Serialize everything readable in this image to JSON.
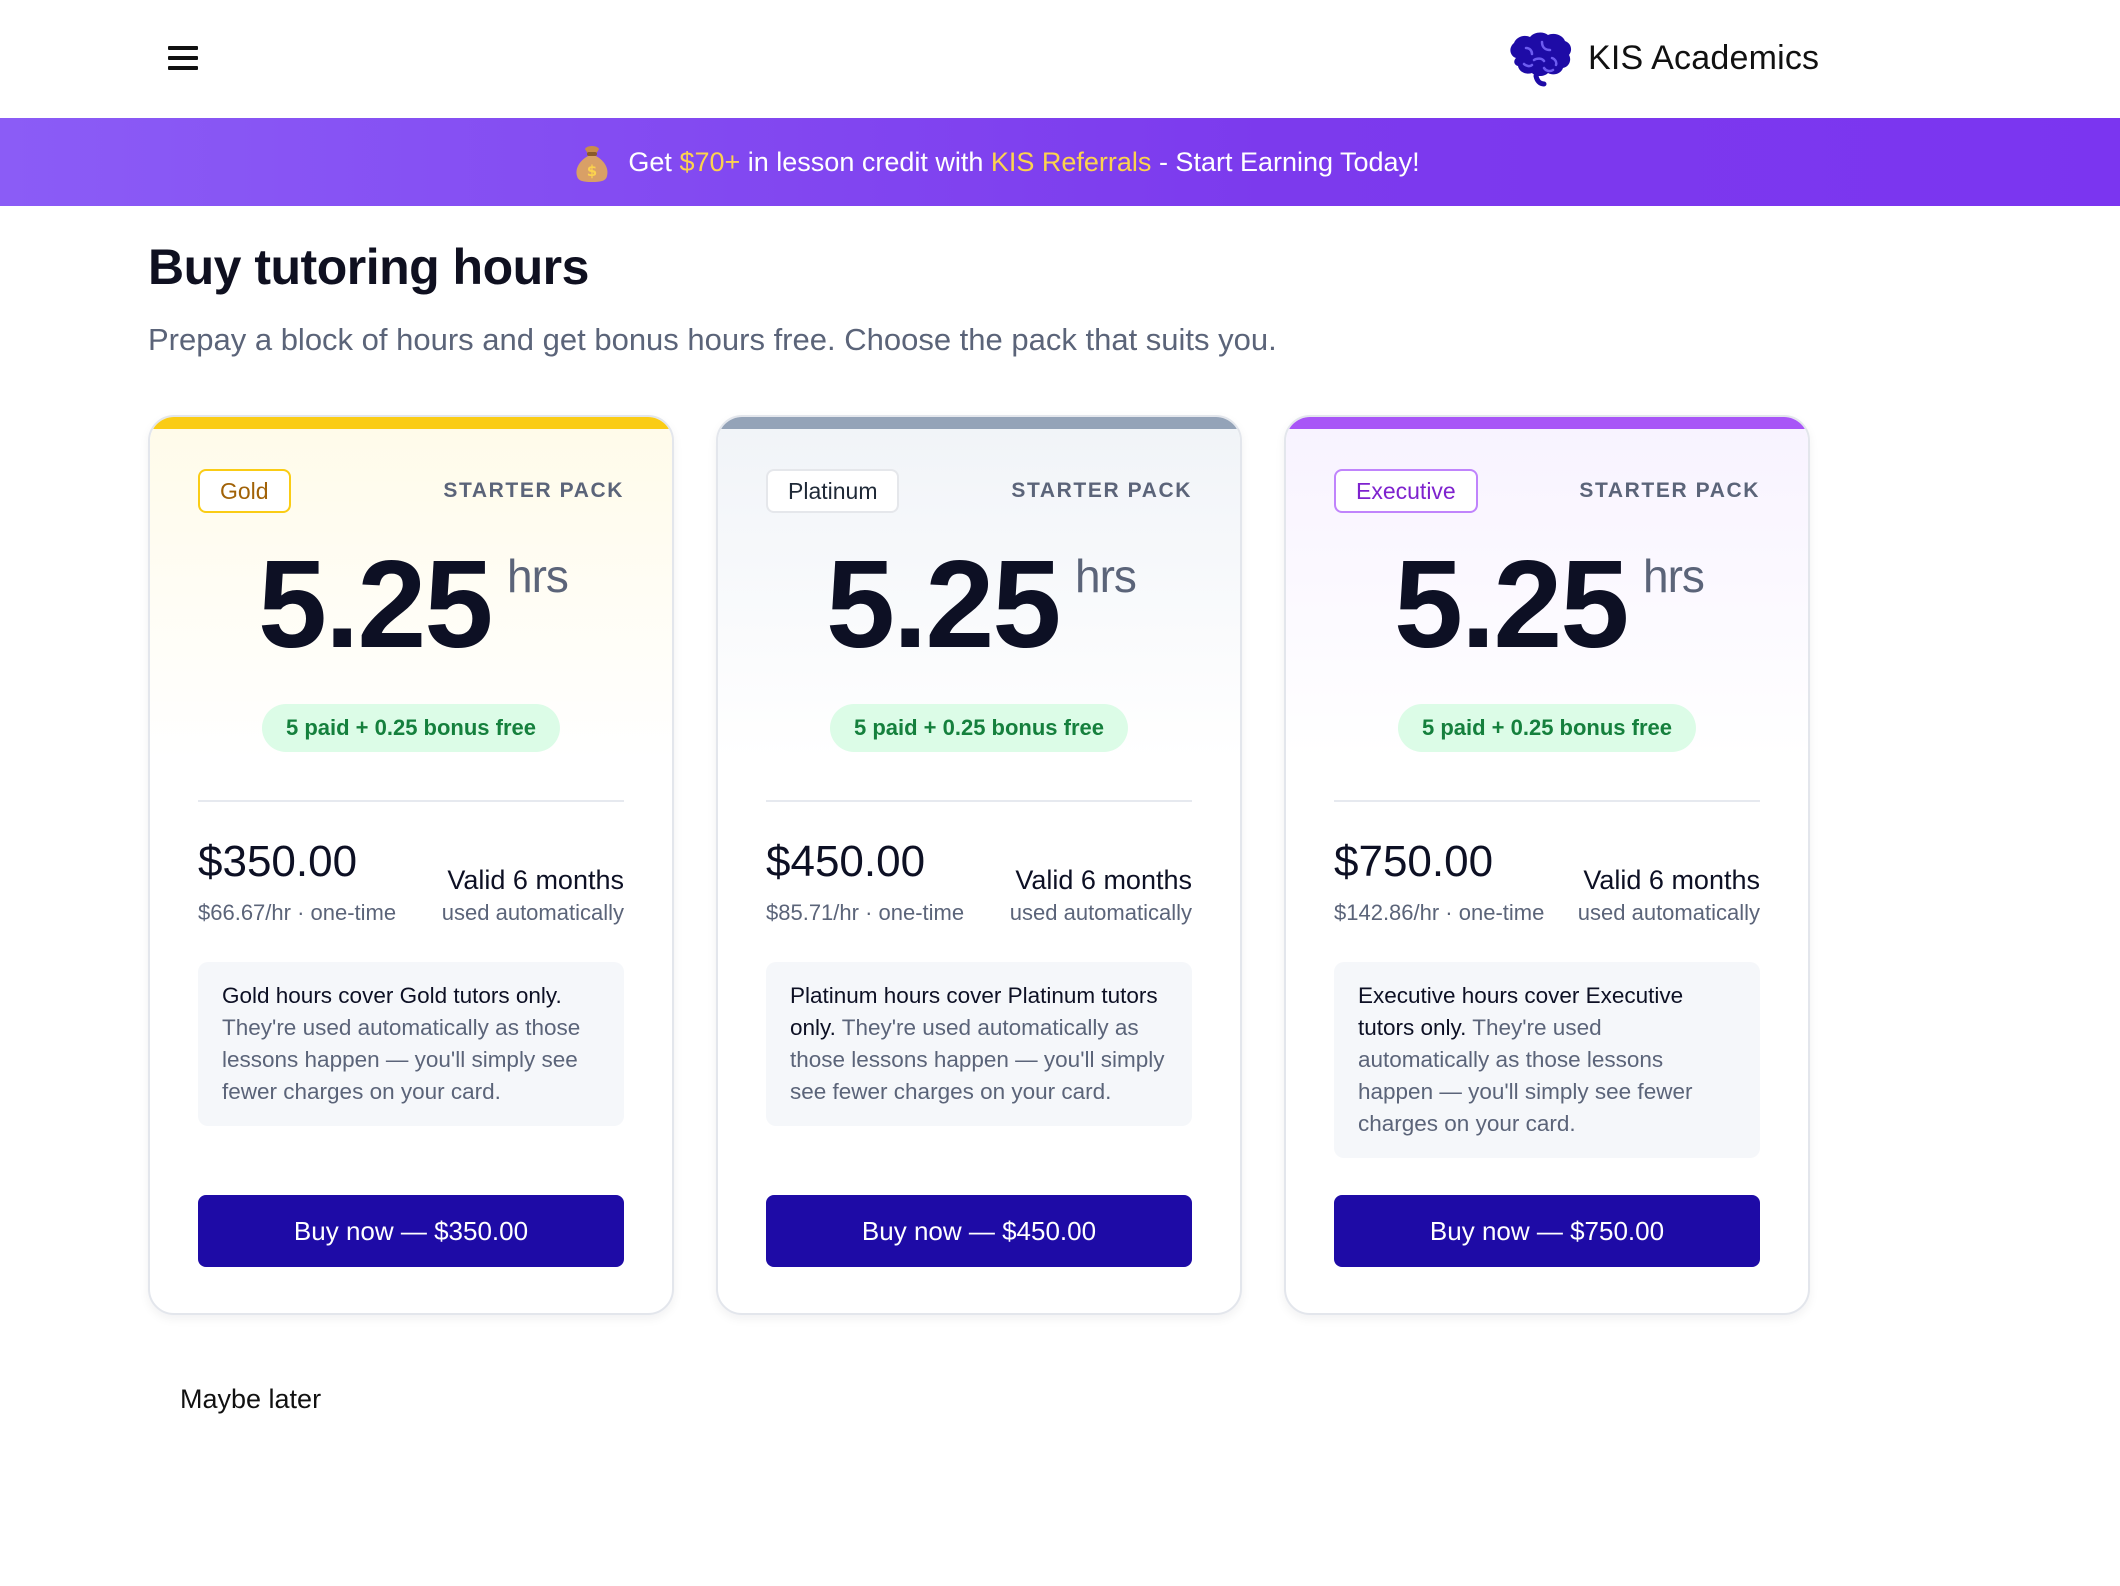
{
  "header": {
    "brand_name": "KIS Academics",
    "menu_icon": "hamburger-menu-icon",
    "logo_icon": "brain-icon"
  },
  "promo": {
    "icon": "money-bag-icon",
    "prefix": "Get ",
    "amount": "$70+",
    "middle": " in lesson credit with ",
    "program": "KIS Referrals",
    "suffix": " - Start Earning Today!"
  },
  "page": {
    "title": "Buy tutoring hours",
    "subtitle": "Prepay a block of hours and get bonus hours free. Choose the pack that suits you."
  },
  "cards": [
    {
      "tier": "Gold",
      "pack": "STARTER PACK",
      "hours": "5.25",
      "unit": "hrs",
      "bonus": "5 paid + 0.25 bonus free",
      "price": "$350.00",
      "per_hour": "$66.67/hr · one-time",
      "valid": "Valid 6 months",
      "used": "used automatically",
      "note_strong": "Gold hours cover Gold tutors only.",
      "note_rest": " They're used automatically as those lessons happen — you'll simply see fewer charges on your card.",
      "button": "Buy now — $350.00",
      "accent": "#facc15"
    },
    {
      "tier": "Platinum",
      "pack": "STARTER PACK",
      "hours": "5.25",
      "unit": "hrs",
      "bonus": "5 paid + 0.25 bonus free",
      "price": "$450.00",
      "per_hour": "$85.71/hr · one-time",
      "valid": "Valid 6 months",
      "used": "used automatically",
      "note_strong": "Platinum hours cover Platinum tutors only.",
      "note_rest": " They're used automatically as those lessons happen — you'll simply see fewer charges on your card.",
      "button": "Buy now — $450.00",
      "accent": "#94a3b8"
    },
    {
      "tier": "Executive",
      "pack": "STARTER PACK",
      "hours": "5.25",
      "unit": "hrs",
      "bonus": "5 paid + 0.25 bonus free",
      "price": "$750.00",
      "per_hour": "$142.86/hr · one-time",
      "valid": "Valid 6 months",
      "used": "used automatically",
      "note_strong": "Executive hours cover Executive tutors only.",
      "note_rest": " They're used automatically as those lessons happen — you'll simply see fewer charges on your card.",
      "button": "Buy now — $750.00",
      "accent": "#a855f7"
    }
  ],
  "footer": {
    "maybe_later": "Maybe later"
  },
  "colors": {
    "primary_button": "#1e0ba6",
    "promo_highlight": "#fcd34d",
    "bonus_green": "#15803d"
  }
}
